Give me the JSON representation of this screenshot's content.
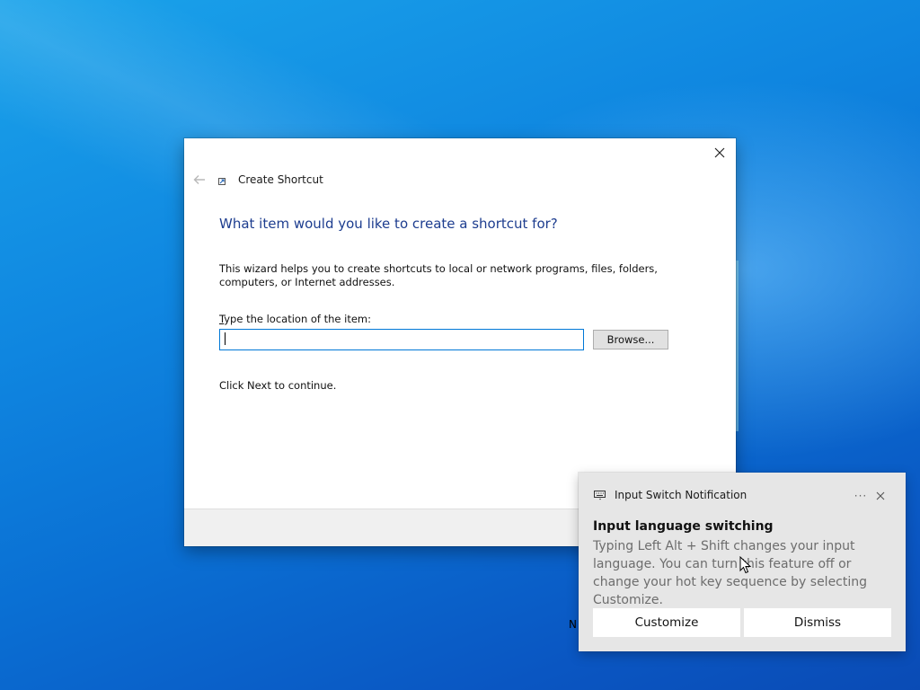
{
  "wizard": {
    "title": "Create Shortcut",
    "heading": "What item would you like to create a shortcut for?",
    "description": "This wizard helps you to create shortcuts to local or network programs, files, folders, computers, or Internet addresses.",
    "location_label_accel": "T",
    "location_label_rest": "ype the location of the item:",
    "location_value": "",
    "browse_label": "Browse...",
    "continue_text": "Click Next to continue.",
    "icons": {
      "back": "back-arrow-icon",
      "app": "shortcut-icon",
      "close": "close-icon"
    }
  },
  "notification": {
    "app_name": "Input Switch Notification",
    "title": "Input language switching",
    "body": "Typing Left Alt + Shift changes your input language. You can turn this feature off or change your hot key sequence by selecting Customize.",
    "more_label": "···",
    "customize_label": "Customize",
    "dismiss_label": "Dismiss",
    "icons": {
      "app": "keyboard-icon",
      "more": "more-options-icon",
      "close": "close-icon"
    }
  },
  "desktop": {
    "stray_text": "N"
  }
}
